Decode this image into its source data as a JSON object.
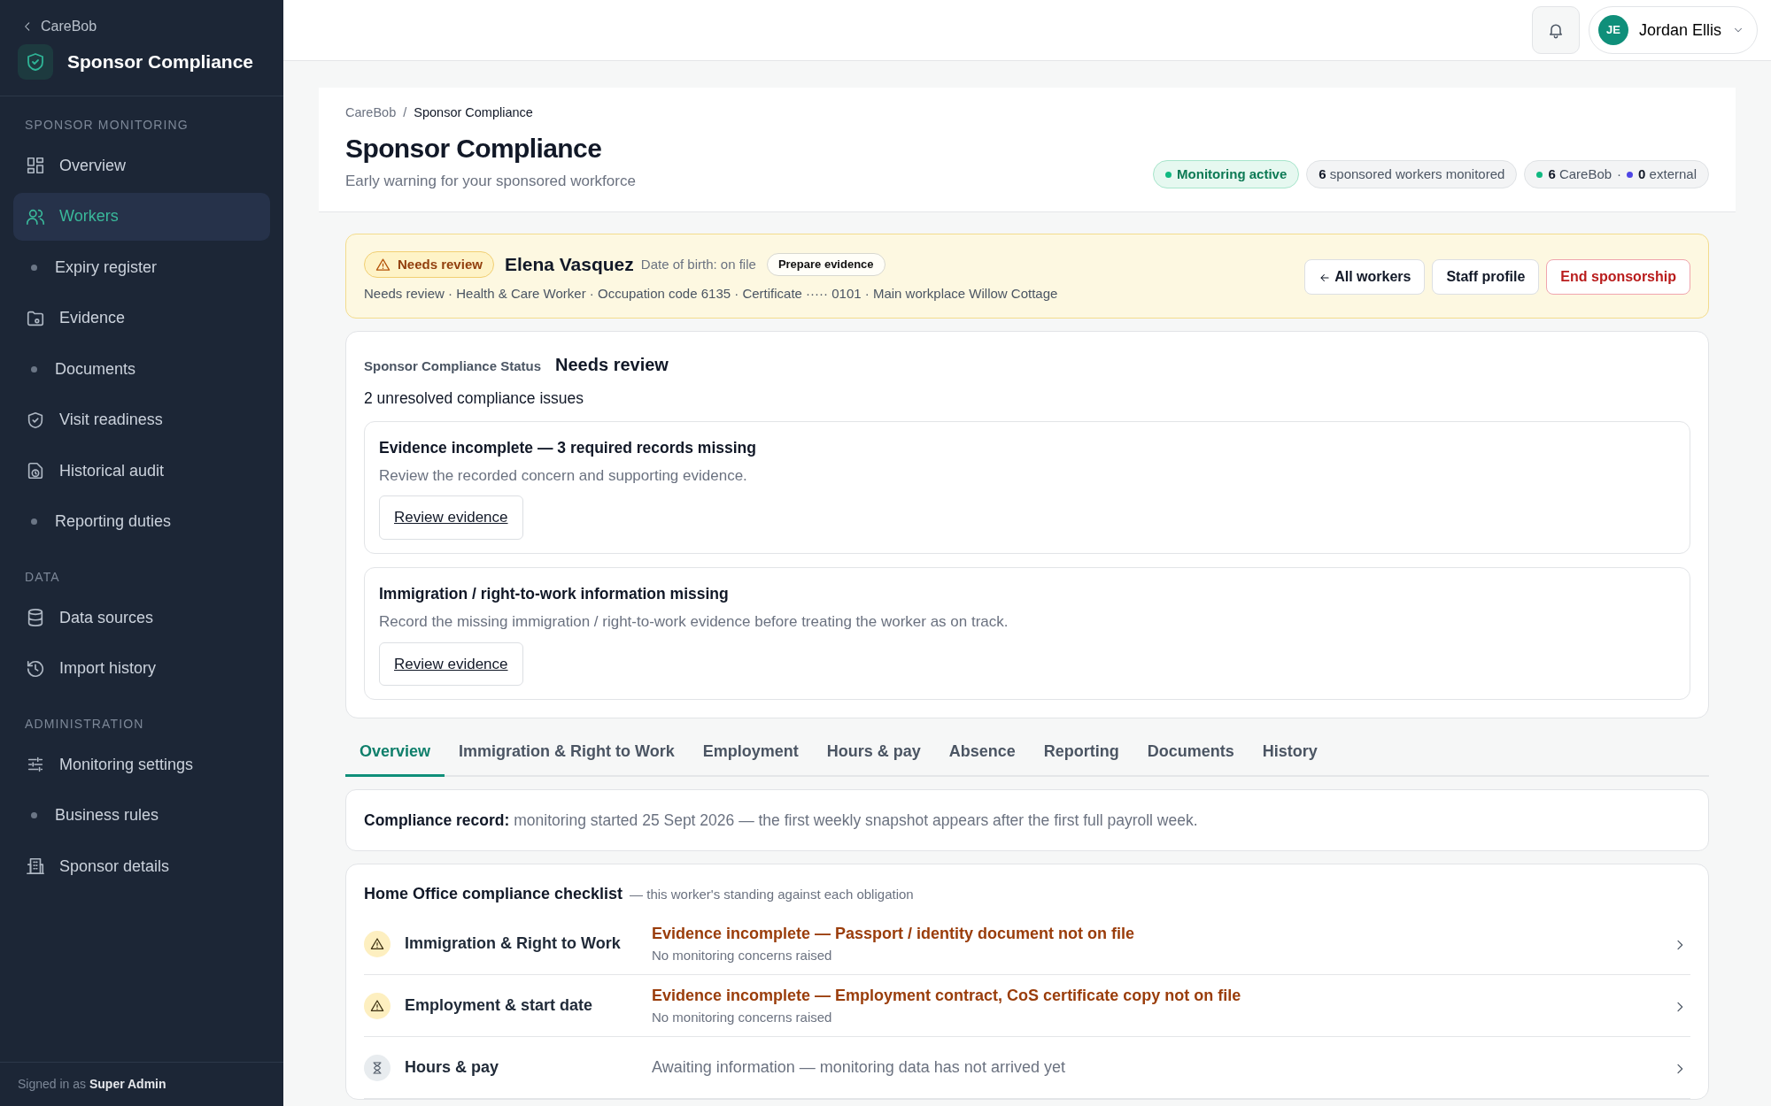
{
  "sidebar": {
    "back_link": "CareBob",
    "app_title": "Sponsor Compliance",
    "sections": [
      {
        "heading": "SPONSOR MONITORING",
        "items": [
          {
            "label": "Overview",
            "kind": "icon",
            "selected": false
          },
          {
            "label": "Workers",
            "kind": "icon",
            "selected": true
          },
          {
            "label": "Expiry register",
            "kind": "dot",
            "selected": false
          },
          {
            "label": "Evidence",
            "kind": "icon",
            "selected": false
          },
          {
            "label": "Documents",
            "kind": "dot",
            "selected": false
          },
          {
            "label": "Visit readiness",
            "kind": "icon",
            "selected": false
          },
          {
            "label": "Historical audit",
            "kind": "icon",
            "selected": false
          },
          {
            "label": "Reporting duties",
            "kind": "dot",
            "selected": false
          }
        ]
      },
      {
        "heading": "DATA",
        "items": [
          {
            "label": "Data sources",
            "kind": "icon",
            "selected": false
          },
          {
            "label": "Import history",
            "kind": "icon",
            "selected": false
          }
        ]
      },
      {
        "heading": "ADMINISTRATION",
        "items": [
          {
            "label": "Monitoring settings",
            "kind": "icon",
            "selected": false
          },
          {
            "label": "Business rules",
            "kind": "dot",
            "selected": false
          },
          {
            "label": "Sponsor details",
            "kind": "icon",
            "selected": false
          }
        ]
      }
    ],
    "footer": {
      "prefix": "Signed in as",
      "user": "Super Admin"
    }
  },
  "topbar": {
    "user": {
      "initials": "JE",
      "name": "Jordan Ellis"
    }
  },
  "header": {
    "breadcrumb": [
      "CareBob",
      "Sponsor Compliance"
    ],
    "breadcrumb_separator": "/",
    "title": "Sponsor Compliance",
    "subtitle": "Early warning for your sponsored workforce",
    "pills": [
      {
        "kind": "status",
        "text": "Monitoring active",
        "color": "#10b981"
      },
      {
        "kind": "count",
        "count": "6",
        "text": "sponsored workers monitored"
      },
      {
        "kind": "split",
        "separator": "·",
        "parts": [
          {
            "count": "6",
            "text": "CareBob",
            "color": "#10b981"
          },
          {
            "count": "0",
            "text": "external",
            "color": "#4f46e5"
          }
        ]
      }
    ]
  },
  "worker": {
    "status": "Needs review",
    "name": "Elena Vasquez",
    "dob": "Date of birth: on file",
    "tag": "Prepare evidence",
    "details": "Needs review · Health & Care Worker · Occupation code 6135 · Certificate ····· 0101 · Main workplace Willow Cottage",
    "buttons": [
      {
        "label": "All workers",
        "kind": "back"
      },
      {
        "label": "Staff profile",
        "kind": "plain"
      },
      {
        "label": "End sponsorship",
        "kind": "danger"
      }
    ]
  },
  "status_card": {
    "label": "Sponsor Compliance Status",
    "value": "Needs review",
    "summary": "2 unresolved compliance issues",
    "issues": [
      {
        "title": "Evidence incomplete — 3 required records missing",
        "text": "Review the recorded concern and supporting evidence.",
        "action": "Review evidence"
      },
      {
        "title": "Immigration / right-to-work information missing",
        "text": "Record the missing immigration / right-to-work evidence before treating the worker as on track.",
        "action": "Review evidence"
      }
    ]
  },
  "tabs": [
    {
      "label": "Overview",
      "selected": true
    },
    {
      "label": "Immigration & Right to Work",
      "selected": false
    },
    {
      "label": "Employment",
      "selected": false
    },
    {
      "label": "Hours & pay",
      "selected": false
    },
    {
      "label": "Absence",
      "selected": false
    },
    {
      "label": "Reporting",
      "selected": false
    },
    {
      "label": "Documents",
      "selected": false
    },
    {
      "label": "History",
      "selected": false
    }
  ],
  "record": "**Compliance record:** monitoring started 25 Sept 2026 — the first weekly snapshot appears after the first full payroll week.",
  "checklist": {
    "title": "Home Office compliance checklist",
    "note": "— this worker's standing against each obligation",
    "rows": [
      {
        "kind": "warning",
        "name": "Immigration & Right to Work",
        "detail": "Evidence incomplete — Passport / identity document not on file",
        "sub": "No monitoring concerns raised"
      },
      {
        "kind": "warning",
        "name": "Employment & start date",
        "detail": "Evidence incomplete — Employment contract, CoS certificate copy not on file",
        "sub": "No monitoring concerns raised"
      },
      {
        "kind": "waiting",
        "name": "Hours & pay",
        "detail": "Awaiting information — monitoring data has not arrived yet"
      }
    ]
  }
}
